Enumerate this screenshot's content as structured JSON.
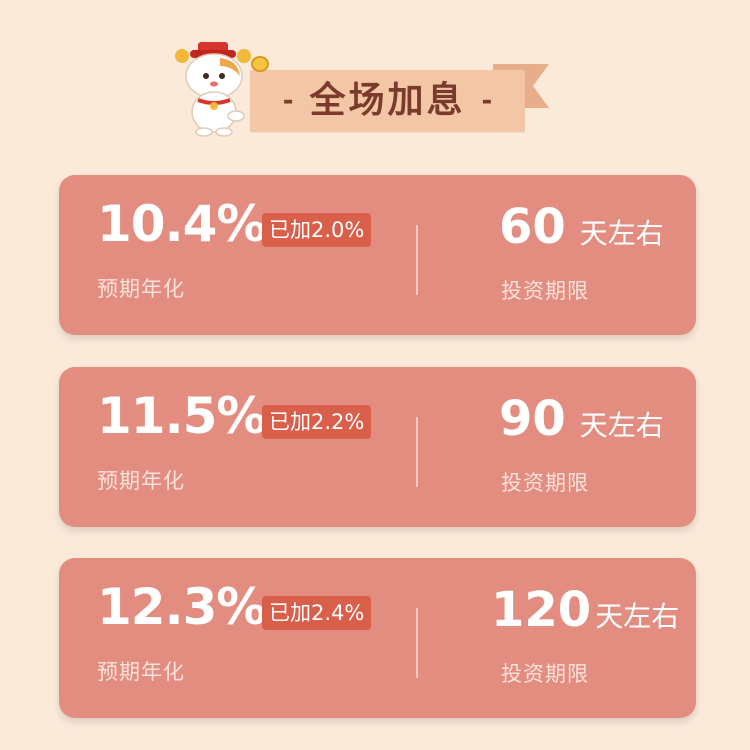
{
  "header": {
    "title": "全场加息",
    "left_dash": "-",
    "right_dash": "-"
  },
  "products": [
    {
      "rate": "10.4%",
      "bonus": "已加2.0%",
      "rate_label": "预期年化",
      "term_number": "60",
      "term_unit": "天左右",
      "term_label": "投资期限"
    },
    {
      "rate": "11.5%",
      "bonus": "已加2.2%",
      "rate_label": "预期年化",
      "term_number": "90",
      "term_unit": "天左右",
      "term_label": "投资期限"
    },
    {
      "rate": "12.3%",
      "bonus": "已加2.4%",
      "rate_label": "预期年化",
      "term_number": "120",
      "term_unit": "天左右",
      "term_label": "投资期限"
    }
  ],
  "colors": {
    "background": "#fbe9da",
    "banner": "#f3c7a6",
    "card": "#e28d80",
    "badge": "#d95f4b",
    "title_text": "#7a3b2c"
  },
  "icons": {
    "mascot": "cat-god-of-wealth-icon",
    "banner_tail": "ribbon-tail-icon"
  }
}
